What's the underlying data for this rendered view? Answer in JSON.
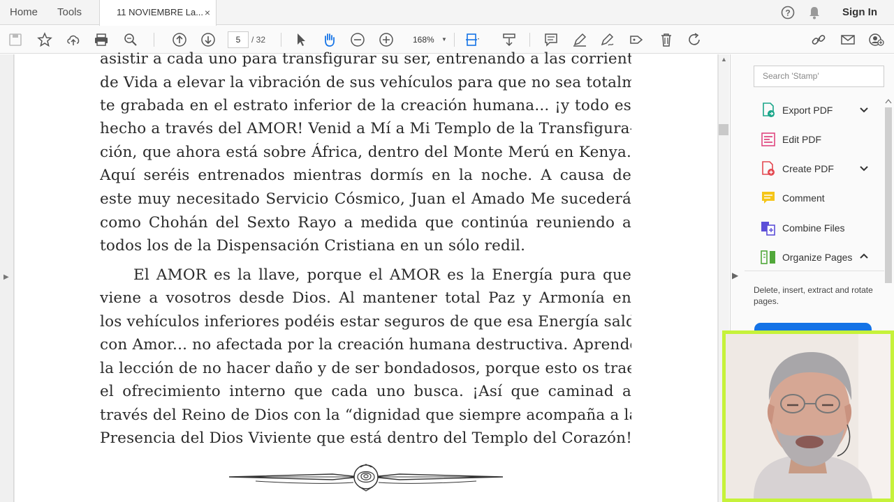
{
  "topbar": {
    "home": "Home",
    "tools": "Tools",
    "doc_tab": "11 NOVIEMBRE La...",
    "close": "×",
    "signin": "Sign In"
  },
  "toolbar": {
    "page_current": "5",
    "page_total": "/ 32",
    "zoom": "168%"
  },
  "document": {
    "lines": [
      "asistir a cada uno para transfigurar su ser, entrenando a las corrientes",
      "de Vida a elevar la vibración de sus vehículos para que no sea totalmen-",
      "te grabada en el estrato inferior de la creación humana... ¡y todo es",
      "hecho a través del AMOR! Venid a Mí a Mi Templo de la Transfigura-",
      "ción, que ahora está sobre África, dentro del Monte Merú en Kenya.",
      "Aquí seréis entrenados mientras dormís en la noche. A causa de",
      "este muy necesitado Servicio Cósmico, Juan el Amado Me sucederá",
      "como Chohán del Sexto Rayo a medida que continúa reuniendo a",
      "todos los de la Dispensación Cristiana en un sólo redil.",
      "El AMOR es la llave, porque el AMOR es la Energía pura que",
      "viene a vosotros desde Dios. Al mantener total Paz y Armonía en",
      "los vehículos inferiores podéis estar seguros de que esa Energía saldrá",
      "con Amor... no afectada por la creación humana destructiva. Aprended",
      "la lección de no hacer daño y de ser bondadosos, porque esto os traerá",
      "el ofrecimiento interno que cada uno busca. ¡Así que caminad a",
      "través del Reino de Dios con la “dignidad que siempre acompaña a la",
      "Presencia del Dios Viviente que está dentro del Templo del Corazón!”"
    ]
  },
  "right_panel": {
    "search_placeholder": "Search 'Stamp'",
    "tools": [
      {
        "label": "Export PDF",
        "icon": "export-pdf-icon",
        "color": "#1aa689"
      },
      {
        "label": "Edit PDF",
        "icon": "edit-pdf-icon",
        "color": "#e0467f"
      },
      {
        "label": "Create PDF",
        "icon": "create-pdf-icon",
        "color": "#e34850"
      },
      {
        "label": "Comment",
        "icon": "comment-icon",
        "color": "#f5c518"
      },
      {
        "label": "Combine Files",
        "icon": "combine-files-icon",
        "color": "#5c4fd8"
      },
      {
        "label": "Organize Pages",
        "icon": "organize-pages-icon",
        "color": "#51a83a"
      }
    ],
    "description": "Delete, insert, extract and rotate pages."
  },
  "colors": {
    "accent": "#1473e6",
    "webcam_border": "#c6f23a"
  }
}
